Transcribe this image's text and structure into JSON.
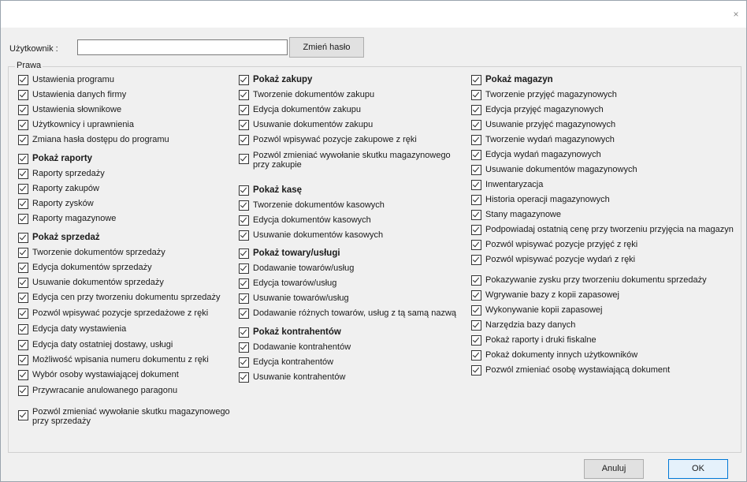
{
  "window": {
    "close_glyph": "×"
  },
  "user": {
    "label": "Użytkownik :",
    "value": "",
    "change_password_label": "Zmień hasło"
  },
  "rights": {
    "label": "Prawa",
    "columns": [
      [
        {
          "label": "Ustawienia programu",
          "bold": false
        },
        {
          "label": "Ustawienia danych firmy",
          "bold": false
        },
        {
          "label": "Ustawienia słownikowe",
          "bold": false
        },
        {
          "label": "Użytkownicy i uprawnienia",
          "bold": false
        },
        {
          "label": "Zmiana hasła dostępu do programu",
          "bold": false
        },
        {
          "label": "Pokaż raporty",
          "bold": true
        },
        {
          "label": "Raporty sprzedaży",
          "bold": false
        },
        {
          "label": "Raporty zakupów",
          "bold": false
        },
        {
          "label": "Raporty zysków",
          "bold": false
        },
        {
          "label": "Raporty magazynowe",
          "bold": false
        },
        {
          "label": "Pokaż sprzedaż",
          "bold": true
        },
        {
          "label": "Tworzenie dokumentów sprzedaży",
          "bold": false
        },
        {
          "label": "Edycja dokumentów sprzedaży",
          "bold": false
        },
        {
          "label": "Usuwanie dokumentów sprzedaży",
          "bold": false
        },
        {
          "label": "Edycja cen przy tworzeniu dokumentu sprzedaży",
          "bold": false
        },
        {
          "label": "Pozwól wpisywać pozycje sprzedażowe z ręki",
          "bold": false
        },
        {
          "label": "Edycja daty wystawienia",
          "bold": false
        },
        {
          "label": "Edycja daty ostatniej dostawy, usługi",
          "bold": false
        },
        {
          "label": "Możliwość wpisania numeru dokumentu z ręki",
          "bold": false
        },
        {
          "label": "Wybór osoby wystawiającej dokument",
          "bold": false
        },
        {
          "label": "Przywracanie anulowanego paragonu",
          "bold": false
        },
        {
          "label": "Pozwól zmieniać wywołanie skutku magazynowego przy sprzedaży",
          "bold": false
        }
      ],
      [
        {
          "label": "Pokaż zakupy",
          "bold": true
        },
        {
          "label": "Tworzenie dokumentów zakupu",
          "bold": false
        },
        {
          "label": "Edycja dokumentów zakupu",
          "bold": false
        },
        {
          "label": "Usuwanie dokumentów zakupu",
          "bold": false
        },
        {
          "label": "Pozwól wpisywać pozycje zakupowe z ręki",
          "bold": false
        },
        {
          "label": "Pozwól zmieniać wywołanie skutku magazynowego przy zakupie",
          "bold": false
        },
        {
          "label": "Pokaż kasę",
          "bold": true
        },
        {
          "label": "Tworzenie dokumentów kasowych",
          "bold": false
        },
        {
          "label": "Edycja dokumentów kasowych",
          "bold": false
        },
        {
          "label": "Usuwanie dokumentów kasowych",
          "bold": false
        },
        {
          "label": "Pokaż towary/usługi",
          "bold": true
        },
        {
          "label": "Dodawanie towarów/usług",
          "bold": false
        },
        {
          "label": "Edycja towarów/usług",
          "bold": false
        },
        {
          "label": "Usuwanie towarów/usług",
          "bold": false
        },
        {
          "label": "Dodawanie różnych towarów, usług z tą samą nazwą",
          "bold": false
        },
        {
          "label": "Pokaż kontrahentów",
          "bold": true
        },
        {
          "label": "Dodawanie kontrahentów",
          "bold": false
        },
        {
          "label": "Edycja kontrahentów",
          "bold": false
        },
        {
          "label": "Usuwanie kontrahentów",
          "bold": false
        }
      ],
      [
        {
          "label": "Pokaż magazyn",
          "bold": true
        },
        {
          "label": "Tworzenie przyjęć magazynowych",
          "bold": false
        },
        {
          "label": "Edycja przyjęć magazynowych",
          "bold": false
        },
        {
          "label": "Usuwanie przyjęć magazynowych",
          "bold": false
        },
        {
          "label": "Tworzenie wydań magazynowych",
          "bold": false
        },
        {
          "label": "Edycja wydań magazynowych",
          "bold": false
        },
        {
          "label": "Usuwanie dokumentów magazynowych",
          "bold": false
        },
        {
          "label": "Inwentaryzacja",
          "bold": false
        },
        {
          "label": "Historia operacji magazynowych",
          "bold": false
        },
        {
          "label": "Stany magazynowe",
          "bold": false
        },
        {
          "label": "Podpowiadaj ostatnią cenę przy tworzeniu przyjęcia na magazyn",
          "bold": false
        },
        {
          "label": "Pozwól wpisywać pozycje przyjęć z ręki",
          "bold": false
        },
        {
          "label": "Pozwól wpisywać pozycje wydań z ręki",
          "bold": false
        },
        {
          "label": "Pokazywanie zysku przy tworzeniu dokumentu sprzedaży",
          "bold": false
        },
        {
          "label": "Wgrywanie bazy z kopii zapasowej",
          "bold": false
        },
        {
          "label": "Wykonywanie kopii zapasowej",
          "bold": false
        },
        {
          "label": "Narzędzia bazy danych",
          "bold": false
        },
        {
          "label": "Pokaż raporty i druki fiskalne",
          "bold": false
        },
        {
          "label": "Pokaż dokumenty innych użytkowników",
          "bold": false
        },
        {
          "label": "Pozwól zmieniać osobę wystawiającą dokument",
          "bold": false
        }
      ]
    ]
  },
  "footer": {
    "cancel_label": "Anuluj",
    "ok_label": "OK"
  }
}
